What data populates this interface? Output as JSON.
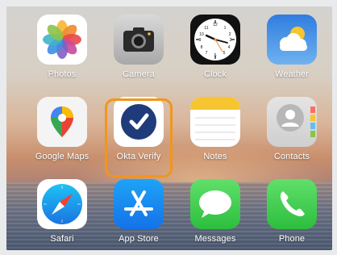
{
  "apps": {
    "photos": {
      "label": "Photos"
    },
    "camera": {
      "label": "Camera"
    },
    "clock": {
      "label": "Clock"
    },
    "weather": {
      "label": "Weather"
    },
    "google_maps": {
      "label": "Google Maps"
    },
    "okta_verify": {
      "label": "Okta Verify"
    },
    "notes": {
      "label": "Notes"
    },
    "contacts": {
      "label": "Contacts"
    },
    "safari": {
      "label": "Safari"
    },
    "app_store": {
      "label": "App Store"
    },
    "messages": {
      "label": "Messages"
    },
    "phone": {
      "label": "Phone"
    }
  },
  "highlight": {
    "target": "okta_verify",
    "color": "#f0961c"
  },
  "icons": [
    "photos-icon",
    "camera-icon",
    "clock-icon",
    "weather-icon",
    "google-maps-icon",
    "okta-verify-icon",
    "notes-icon",
    "contacts-icon",
    "safari-icon",
    "app-store-icon",
    "messages-icon",
    "phone-icon"
  ]
}
